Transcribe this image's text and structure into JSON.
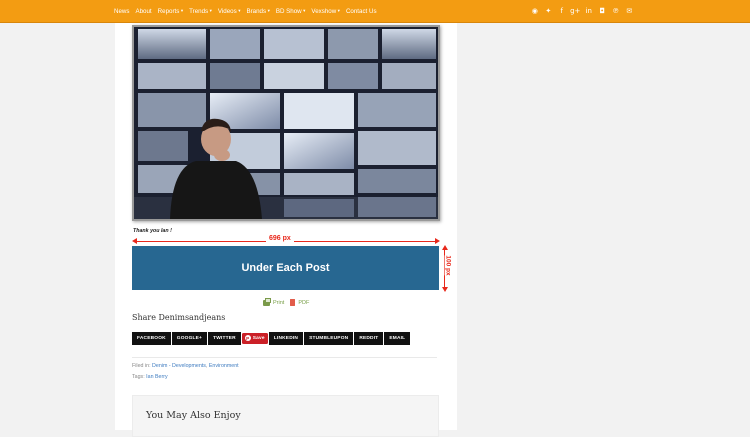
{
  "nav": {
    "items": [
      {
        "label": "News",
        "caret": false
      },
      {
        "label": "About",
        "caret": false
      },
      {
        "label": "Reports",
        "caret": true
      },
      {
        "label": "Trends",
        "caret": true
      },
      {
        "label": "Videos",
        "caret": true
      },
      {
        "label": "Brands",
        "caret": true
      },
      {
        "label": "BD Show",
        "caret": true
      },
      {
        "label": "Vexshow",
        "caret": true
      },
      {
        "label": "Contact Us",
        "caret": false
      }
    ],
    "caret_glyph": "▾"
  },
  "social": {
    "icons": [
      {
        "name": "rss-icon",
        "glyph": "◉"
      },
      {
        "name": "twitter-icon",
        "glyph": "✦"
      },
      {
        "name": "facebook-icon",
        "glyph": "f"
      },
      {
        "name": "google-plus-icon",
        "glyph": "g+"
      },
      {
        "name": "linkedin-icon",
        "glyph": "in"
      },
      {
        "name": "instagram-icon",
        "glyph": "◘"
      },
      {
        "name": "pinterest-icon",
        "glyph": "℗"
      },
      {
        "name": "email-icon",
        "glyph": "✉"
      }
    ]
  },
  "post": {
    "thanks": "Thank you Ian !",
    "ad": {
      "width_label": "696 px",
      "height_label": "100 px",
      "text": "Under Each Post",
      "color": "#276791"
    },
    "print_label": "Print",
    "pdf_label": "PDF",
    "share_title": "Share Denimsandjeans",
    "share_buttons": [
      {
        "label": "FACEBOOK",
        "name": "share-facebook-button"
      },
      {
        "label": "GOOGLE+",
        "name": "share-google-plus-button"
      },
      {
        "label": "TWITTER",
        "name": "share-twitter-button"
      },
      {
        "label": "Save",
        "name": "pinterest-save-button"
      },
      {
        "label": "LINKEDIN",
        "name": "share-linkedin-button"
      },
      {
        "label": "STUMBLEUPON",
        "name": "share-stumbleupon-button"
      },
      {
        "label": "REDDIT",
        "name": "share-reddit-button"
      },
      {
        "label": "EMAIL",
        "name": "share-email-button"
      }
    ],
    "filed_in_label": "Filed in:",
    "categories": [
      "Denim - Developments",
      "Environment"
    ],
    "tags_label": "Tags:",
    "tags": [
      "Ian Berry"
    ],
    "related_title": "You May Also Enjoy"
  },
  "colors": {
    "nav_bg": "#f39c12",
    "link": "#3f7cc0",
    "accent_red": "#e8281b"
  }
}
